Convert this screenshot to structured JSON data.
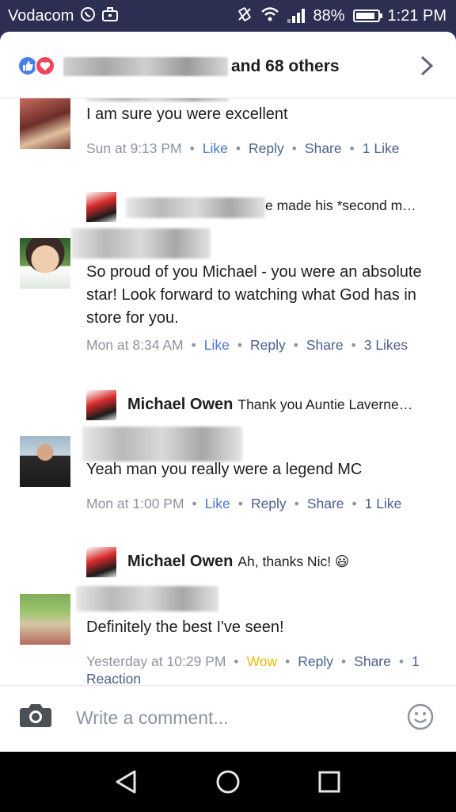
{
  "status_bar": {
    "carrier": "Vodacom",
    "battery_percent": "88%",
    "battery_level": 0.88,
    "time": "1:21 PM",
    "icons": [
      "whatsapp-icon",
      "briefcase-icon",
      "vibrate-icon",
      "wifi-icon",
      "signal-icon",
      "battery-icon"
    ]
  },
  "header": {
    "reaction_types": [
      "like",
      "love"
    ],
    "reactors_suffix": "and 68 others",
    "colors": {
      "like": "#4a7fe8",
      "love": "#f0445d"
    }
  },
  "comments": [
    {
      "text": "I am sure you were excellent",
      "time": "Sun at 9:13 PM",
      "actions": {
        "like": "Like",
        "reply": "Reply",
        "share": "Share"
      },
      "count": "1",
      "count_label": "Like",
      "reply_preview": {
        "text": "e made his *second m…"
      }
    },
    {
      "text": "So proud of you Michael - you were an absolute star! Look forward to watching what God has in store for you.",
      "time": "Mon at 8:34 AM",
      "actions": {
        "like": "Like",
        "reply": "Reply",
        "share": "Share"
      },
      "count": "3",
      "count_label": "Likes",
      "reply_preview": {
        "author": "Michael Owen",
        "text": "Thank you Auntie Laverne…"
      }
    },
    {
      "text": "Yeah man you really were a legend MC",
      "time": "Mon at 1:00 PM",
      "actions": {
        "like": "Like",
        "reply": "Reply",
        "share": "Share"
      },
      "count": "1",
      "count_label": "Like",
      "reply_preview": {
        "author": "Michael Owen",
        "text": "Ah, thanks Nic! 😃"
      }
    },
    {
      "text": "Definitely the best I've seen!",
      "time": "Yesterday at 10:29 PM",
      "actions": {
        "like": "Wow",
        "reply": "Reply",
        "share": "Share"
      },
      "count": "1",
      "count_label": "Reaction"
    }
  ],
  "composer": {
    "placeholder": "Write a comment..."
  }
}
